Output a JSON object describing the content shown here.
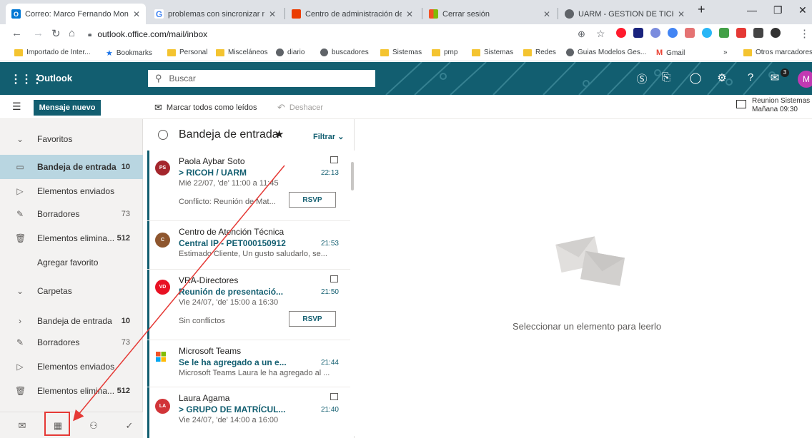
{
  "browser": {
    "tabs": [
      {
        "title": "Correo: Marco Fernando Mono",
        "icon": "outlook-icon",
        "color": "#0078d4",
        "glyph": "O",
        "active": true
      },
      {
        "title": "problemas con sincronizar mic",
        "icon": "google-icon",
        "color": "#4285f4",
        "glyph": "G",
        "active": false
      },
      {
        "title": "Centro de administración de M",
        "icon": "office-icon",
        "color": "#eb3c00",
        "glyph": "",
        "active": false
      },
      {
        "title": "Cerrar sesión",
        "icon": "microsoft-icon",
        "color": "#f35325",
        "glyph": "",
        "active": false
      },
      {
        "title": "UARM - GESTION DE TICKETS",
        "icon": "globe-icon",
        "color": "#5f6368",
        "glyph": "",
        "active": false
      }
    ],
    "new_tab": "+",
    "url": "outlook.office.com/mail/inbox",
    "bookmarks": [
      {
        "label": "Importado de Inter...",
        "type": "folder"
      },
      {
        "label": "Bookmarks",
        "type": "star"
      },
      {
        "label": "Personal",
        "type": "folder"
      },
      {
        "label": "Misceláneos",
        "type": "folder"
      },
      {
        "label": "diario",
        "type": "globe"
      },
      {
        "label": "buscadores",
        "type": "globe"
      },
      {
        "label": "Sistemas",
        "type": "folder"
      },
      {
        "label": "pmp",
        "type": "folder"
      },
      {
        "label": "Sistemas",
        "type": "folder"
      },
      {
        "label": "Redes",
        "type": "folder"
      },
      {
        "label": "Guias Modelos Ges...",
        "type": "globe"
      },
      {
        "label": "Gmail",
        "type": "gmail"
      }
    ],
    "bookmarks_more": "»",
    "other_bookmarks": "Otros marcadores"
  },
  "owa": {
    "brand": "Outlook",
    "search_placeholder": "Buscar",
    "notification_count": "3",
    "avatar_initial": "M",
    "new_message": "Mensaje nuevo",
    "mark_all_read": "Marcar todos como leídos",
    "undo": "Deshacer",
    "reminder_title": "Reunion Sistemas",
    "reminder_time": "Mañana 09:30"
  },
  "nav": {
    "favorites_label": "Favoritos",
    "favorites": [
      {
        "label": "Bandeja de entrada",
        "count": "10",
        "icon": "inbox-icon",
        "selected": true
      },
      {
        "label": "Elementos enviados",
        "count": "",
        "icon": "send-icon"
      },
      {
        "label": "Borradores",
        "count": "73",
        "icon": "pencil-icon"
      },
      {
        "label": "Elementos elimina...",
        "count": "512",
        "icon": "trash-icon"
      }
    ],
    "add_favorite": "Agregar favorito",
    "folders_label": "Carpetas",
    "folders": [
      {
        "label": "Bandeja de entrada",
        "count": "10",
        "icon": "chevron-right-icon"
      },
      {
        "label": "Borradores",
        "count": "73",
        "icon": "pencil-icon"
      },
      {
        "label": "Elementos enviados",
        "count": "",
        "icon": "send-icon"
      },
      {
        "label": "Elementos elimina...",
        "count": "512",
        "icon": "trash-icon"
      }
    ]
  },
  "list": {
    "title": "Bandeja de entrada",
    "filter": "Filtrar",
    "messages": [
      {
        "from": "Paola Aybar Soto",
        "initials": "PS",
        "avatar_color": "#a4262c",
        "subject": "> RICOH / UARM",
        "time": "22:13",
        "line3": "Mié 22/07, 'de' 11:00 a 11:45",
        "line4": "Conflicto: Reunión de Mat...",
        "rsvp": "RSVP",
        "calendar": true
      },
      {
        "from": "Centro de Atención Técnica",
        "initials": "C",
        "avatar_color": "#8e562e",
        "subject": "Central IP - PET000150912",
        "time": "21:53",
        "line3": "Estimado Cliente, Un gusto saludarlo, se...",
        "line4": "",
        "rsvp": "",
        "calendar": false
      },
      {
        "from": "VRA-Directores",
        "initials": "VD",
        "avatar_color": "#e81123",
        "subject": "Reunión de presentació...",
        "time": "21:50",
        "line3": "Vie 24/07, 'de' 15:00 a 16:30",
        "line4": "Sin conflictos",
        "rsvp": "RSVP",
        "calendar": true
      },
      {
        "from": "Microsoft Teams",
        "initials": "",
        "avatar_color": "",
        "subject": "Se le ha agregado a un e...",
        "time": "21:44",
        "line3": "Microsoft Teams Laura le ha agregado al ...",
        "line4": "",
        "rsvp": "",
        "calendar": false
      },
      {
        "from": "Laura Agama",
        "initials": "LA",
        "avatar_color": "#d13438",
        "subject": "> GRUPO DE MATRÍCUL...",
        "time": "21:40",
        "line3": "Vie 24/07, 'de' 14:00 a 16:00",
        "line4": "",
        "rsvp": "",
        "calendar": true
      }
    ]
  },
  "reading": {
    "empty_text": "Seleccionar un elemento para leerlo"
  },
  "annotation": {
    "arrow_color": "#e53935",
    "highlight_color": "#e53935"
  }
}
